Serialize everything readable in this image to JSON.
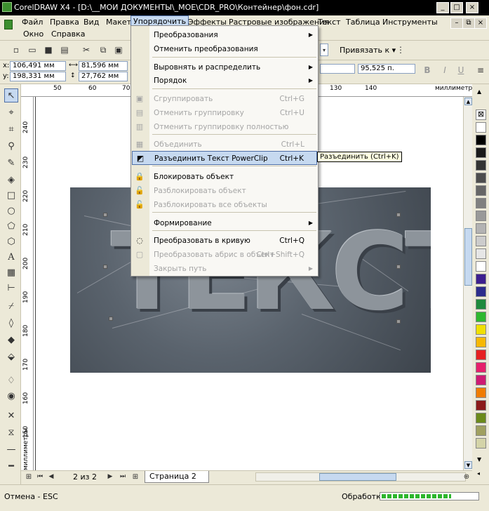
{
  "window": {
    "title": "CorelDRAW X4 - [D:\\__МОИ ДОКУМЕНТЫ\\_МОЕ\\CDR_PRO\\Контейнер\\фон.cdr]",
    "controls": [
      "_",
      "□",
      "×"
    ],
    "doc_controls": [
      "–",
      "⧉",
      "×"
    ]
  },
  "menubar": {
    "items": [
      "Файл",
      "Правка",
      "Вид",
      "Макет",
      "Упорядочить",
      "Эффекты",
      "Растровые изображения",
      "Текст",
      "Таблица",
      "Инструменты",
      "Окно",
      "Справка"
    ],
    "active": "Упорядочить"
  },
  "toolbar": {
    "snap_label": "Привязать к",
    "snap_arrow": "▾"
  },
  "propertybar": {
    "x_label": "x:",
    "x_value": "106,491 мм",
    "y_label": "y:",
    "y_value": "198,331 мм",
    "width_value": "81,596 мм",
    "height_value": "27,762 мм",
    "font_size": "95,525 п."
  },
  "ruler": {
    "h_ticks": [
      "50",
      "60",
      "70",
      "130",
      "140"
    ],
    "h_unit": "миллиметры",
    "v_ticks": [
      "240",
      "230",
      "220",
      "210",
      "200",
      "190",
      "180",
      "170",
      "160",
      "150"
    ],
    "v_unit": "миллиметры"
  },
  "canvas": {
    "embossed_text": "ТЕКСТ"
  },
  "arrange_menu": {
    "items": [
      {
        "label": "Преобразования",
        "shortcut": "",
        "submenu": true,
        "enabled": true,
        "icon": ""
      },
      {
        "label": "Отменить преобразования",
        "shortcut": "",
        "submenu": false,
        "enabled": true,
        "icon": ""
      },
      {
        "label": "Выровнять и распределить",
        "shortcut": "",
        "submenu": true,
        "enabled": true,
        "icon": ""
      },
      {
        "label": "Порядок",
        "shortcut": "",
        "submenu": true,
        "enabled": true,
        "icon": ""
      },
      {
        "label": "Сгруппировать",
        "shortcut": "Ctrl+G",
        "submenu": false,
        "enabled": false,
        "icon": "group-icon"
      },
      {
        "label": "Отменить группировку",
        "shortcut": "Ctrl+U",
        "submenu": false,
        "enabled": false,
        "icon": "ungroup-icon"
      },
      {
        "label": "Отменить группировку полностью",
        "shortcut": "",
        "submenu": false,
        "enabled": false,
        "icon": "ungroup-all-icon"
      },
      {
        "label": "Объединить",
        "shortcut": "Ctrl+L",
        "submenu": false,
        "enabled": false,
        "icon": "combine-icon"
      },
      {
        "label": "Разъединить Текст PowerClip",
        "shortcut": "Ctrl+K",
        "submenu": false,
        "enabled": true,
        "icon": "break-apart-icon",
        "highlighted": true
      },
      {
        "label": "Блокировать объект",
        "shortcut": "",
        "submenu": false,
        "enabled": true,
        "icon": "lock-icon"
      },
      {
        "label": "Разблокировать объект",
        "shortcut": "",
        "submenu": false,
        "enabled": false,
        "icon": "unlock-icon"
      },
      {
        "label": "Разблокировать все объекты",
        "shortcut": "",
        "submenu": false,
        "enabled": false,
        "icon": "unlock-all-icon"
      },
      {
        "label": "Формирование",
        "shortcut": "",
        "submenu": true,
        "enabled": true,
        "icon": ""
      },
      {
        "label": "Преобразовать в кривую",
        "shortcut": "Ctrl+Q",
        "submenu": false,
        "enabled": true,
        "icon": "convert-curve-icon"
      },
      {
        "label": "Преобразовать абрис в объект",
        "shortcut": "Ctrl+Shift+Q",
        "submenu": false,
        "enabled": false,
        "icon": "outline-to-object-icon"
      },
      {
        "label": "Закрыть путь",
        "shortcut": "",
        "submenu": true,
        "enabled": false,
        "icon": ""
      }
    ]
  },
  "tooltip": "Разъединить (Ctrl+K)",
  "pagebar": {
    "page_count": "2 из 2",
    "page_tab": "Страница 2"
  },
  "statusbar": {
    "left_text": "Отмена - ESC",
    "right_label": "Обработка",
    "progress": 0.72
  },
  "palette_colors": [
    "#ffffff",
    "#000000",
    "#1a1a1a",
    "#333333",
    "#4d4d4d",
    "#666666",
    "#808080",
    "#999999",
    "#b3b3b3",
    "#cccccc",
    "#e6e6e6",
    "#ffffff",
    "#3d1f8f",
    "#2c2c8c",
    "#1e8a3c",
    "#2eb82e",
    "#f0e000",
    "#f7b800",
    "#e62020",
    "#e6206b",
    "#ce1b73",
    "#f07c00",
    "#8b1a1a",
    "#6b8a1a",
    "#a0a060",
    "#d4d4a8"
  ]
}
